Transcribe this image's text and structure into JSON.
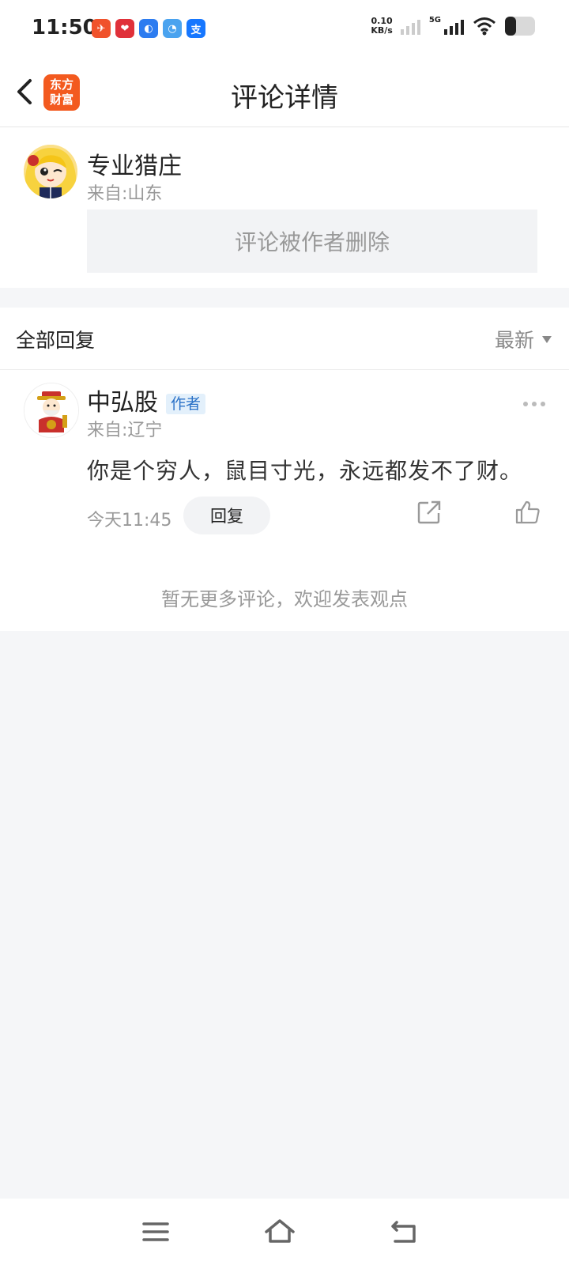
{
  "status_bar": {
    "time": "11:50",
    "speed_value": "0.10",
    "speed_unit": "KB/s",
    "network": "5G",
    "app_icons": [
      {
        "name": "paper-plane-app-icon",
        "glyph": "✈",
        "color": "#f0522b"
      },
      {
        "name": "heart-app-icon",
        "glyph": "❤",
        "color": "#e0313a"
      },
      {
        "name": "browser-app-icon",
        "glyph": "◐",
        "color": "#2d7cf0"
      },
      {
        "name": "bird-app-icon",
        "glyph": "◔",
        "color": "#4aa3ef"
      },
      {
        "name": "alipay-app-icon",
        "glyph": "支",
        "color": "#1677ff"
      }
    ]
  },
  "header": {
    "title": "评论详情",
    "logo_line1": "东方",
    "logo_line2": "财富"
  },
  "comment": {
    "user_name": "专业猎庄",
    "location": "来自:山东",
    "deleted_text": "评论被作者删除"
  },
  "replies_header": {
    "title": "全部回复",
    "sort_label": "最新"
  },
  "reply": {
    "user_name": "中弘股",
    "badge": "作者",
    "location": "来自:辽宁",
    "text": "你是个穷人，鼠目寸光，永远都发不了财。",
    "time": "今天11:45",
    "reply_label": "回复"
  },
  "footer_text": "暂无更多评论，欢迎发表观点",
  "colors": {
    "brand": "#f35a1f",
    "badge_bg": "#e3f0fb",
    "badge_text": "#2a71c7",
    "page_bg": "#f5f6f8"
  }
}
